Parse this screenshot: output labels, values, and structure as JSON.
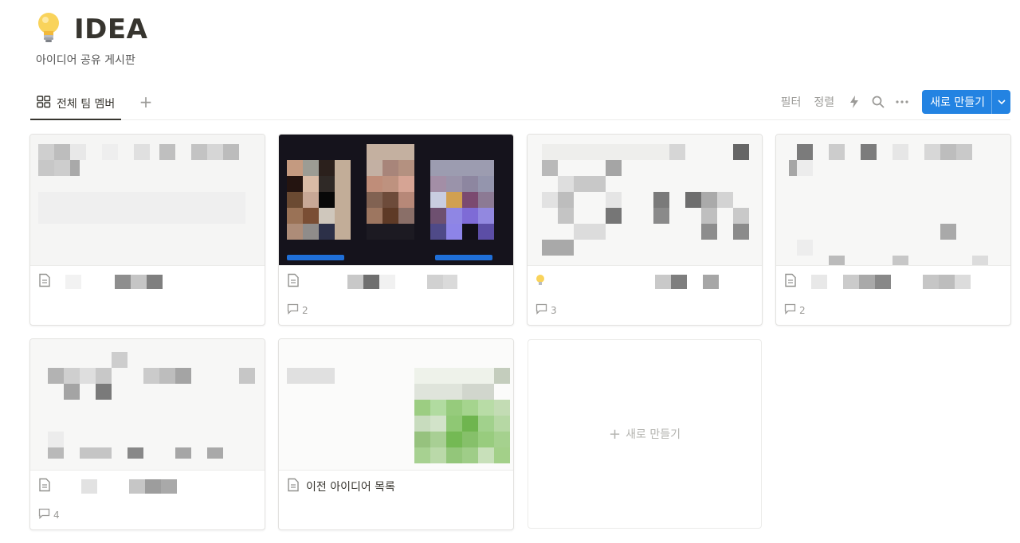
{
  "page": {
    "icon": "lightbulb-icon",
    "title": "IDEA",
    "description": "아이디어 공유 게시판"
  },
  "views": [
    {
      "label": "전체 팀 멤버",
      "icon": "gallery-icon",
      "active": true
    }
  ],
  "toolbar": {
    "filter_label": "필터",
    "sort_label": "정렬",
    "new_label": "새로 만들기"
  },
  "cards": [
    {
      "icon": "page-icon",
      "title": "",
      "comments": null
    },
    {
      "icon": "page-icon",
      "title": "",
      "comments": "2"
    },
    {
      "icon": "lightbulb-icon",
      "title": "",
      "comments": "3"
    },
    {
      "icon": "page-icon",
      "title": "",
      "comments": "2"
    },
    {
      "icon": "page-icon",
      "title": "",
      "comments": "4"
    },
    {
      "icon": "page-icon",
      "title": "이전 아이디어 목록",
      "comments": null
    }
  ],
  "new_card": {
    "label": "새로 만들기"
  },
  "colors": {
    "accent": "#2383e2",
    "text": "#37352f",
    "muted": "#9b9a97"
  }
}
